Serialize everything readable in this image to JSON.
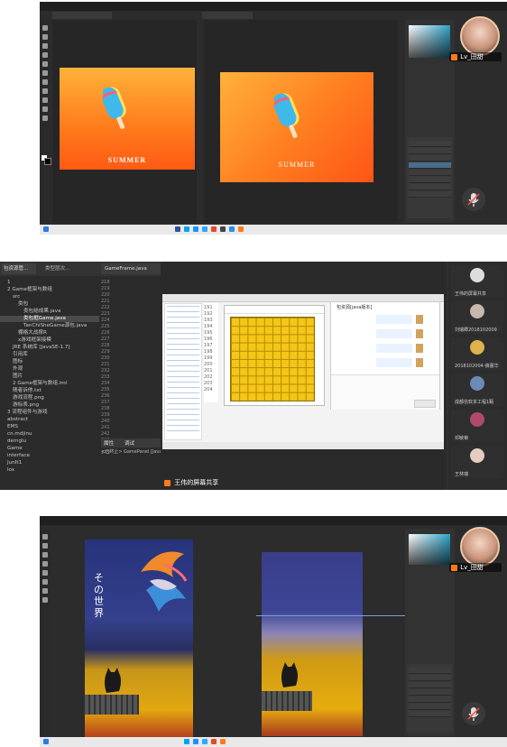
{
  "top": {
    "artboard_text_left": "SUMMER",
    "artboard_text_right": "SUMMER",
    "user_name": "Lv_田甜",
    "colors": {
      "bg": "#2b2b2b",
      "grad_start": "#ff6a00",
      "grad_end": "#ffc53a"
    }
  },
  "middle": {
    "tabs": [
      "包资源管...",
      "类型层次...",
      "GameFrame.java",
      "GamePanel.java"
    ],
    "line_numbers": [
      "218",
      "219",
      "220",
      "221",
      "222",
      "223",
      "224",
      "225",
      "226",
      "227",
      "228",
      "229",
      "230",
      "231",
      "232",
      "233",
      "234",
      "235",
      "236",
      "237",
      "238",
      "239",
      "240",
      "241",
      "242",
      "243",
      "244",
      "245"
    ],
    "inner_line_numbers": [
      "191",
      "192",
      "193",
      "194",
      "195",
      "196",
      "197",
      "198",
      "199",
      "200",
      "201",
      "202",
      "203",
      "204"
    ],
    "tree": [
      "1",
      "2 Game框架与数组",
      "src",
      "类包",
      "类包结成果.java",
      "类包框Game.java",
      "TanChiSheGame源包.java",
      "棚格大战撑R",
      "x游戏框架接模",
      "JRE 系统库 [JavaSE-1.7]",
      "引用库",
      "图标",
      "外观",
      "图片",
      "2 Game框架与数组.iml",
      "随者诉他.txt",
      "游戏流程.png",
      "游标表.png",
      "3 流程组件与游戏",
      "abstract",
      "EMS",
      "cn.mdjinu",
      "demglu",
      "Game",
      "interface",
      "JunIt1",
      "lox"
    ],
    "bottom_tabs": [
      "属性",
      "调试"
    ],
    "bottom_status": "<已终止> GamePanel [Java",
    "share_label": "王伟的屏幕共享",
    "chat_title": "包资源[java版本]",
    "participants": [
      "王伟的屏幕共享",
      "刘瑞卿2018102009",
      "2018102004-薛蕾华",
      "成都信软本工程1甄",
      "邓敏菊",
      "王林瑞"
    ],
    "grid": {
      "rows": 10,
      "cols": 10,
      "color": "#f5c518"
    }
  },
  "bottom": {
    "title_vertical": "その世界",
    "user_name": "Lv_田甜"
  }
}
